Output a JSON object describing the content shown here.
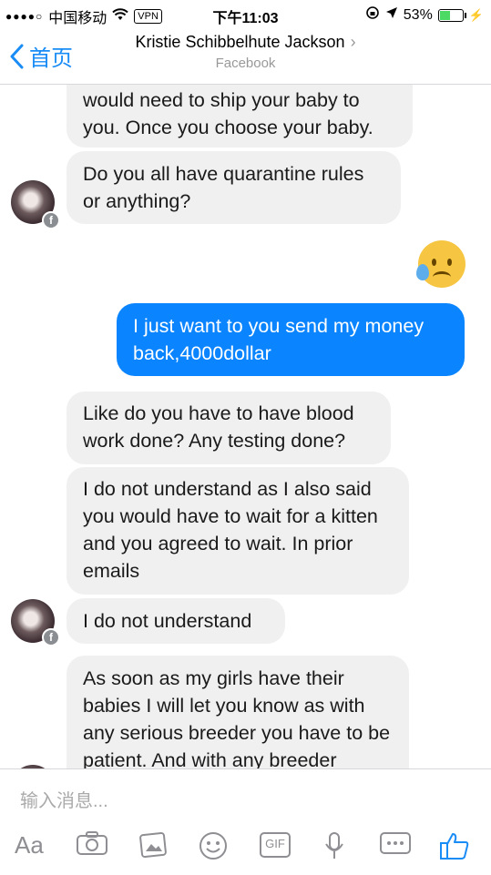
{
  "status_bar": {
    "signal": "●●●●○",
    "carrier": "中国移动",
    "wifi_icon": "wifi-icon",
    "vpn": "VPN",
    "time": "下午11:03",
    "battery_percent": "53%",
    "battery_level": 0.53
  },
  "nav": {
    "back_label": "首页",
    "title": "Kristie Schibbelhute Jackson",
    "subtitle": "Facebook"
  },
  "messages": [
    {
      "side": "in",
      "text": "would need to ship your baby to you. Once you choose your baby."
    },
    {
      "side": "in",
      "text": "Do you all have quarantine rules or anything?"
    },
    {
      "side": "out",
      "emoji": "sad-sweat-emoji"
    },
    {
      "side": "out",
      "text": "I just want to you send my money back,4000dollar"
    },
    {
      "side": "in",
      "text": "Like do you have to have blood work done? Any testing done?"
    },
    {
      "side": "in",
      "text": "I do not understand as I also said you would have to wait for a kitten and you agreed to wait. In prior emails"
    },
    {
      "side": "in",
      "text": "I do not understand"
    },
    {
      "side": "in",
      "text": "As soon as my girls have their babies I will let you know as with any serious breeder you have to be patient. And with any breeder"
    }
  ],
  "composer": {
    "placeholder": "输入消息...",
    "tools": [
      "Aa",
      "camera-icon",
      "photo-icon",
      "emoji-icon",
      "GIF",
      "mic-icon",
      "more-icon",
      "like-icon"
    ]
  },
  "colors": {
    "accent": "#0a84ff",
    "incoming_bubble": "#f1f0f0",
    "battery": "#4cd964"
  }
}
